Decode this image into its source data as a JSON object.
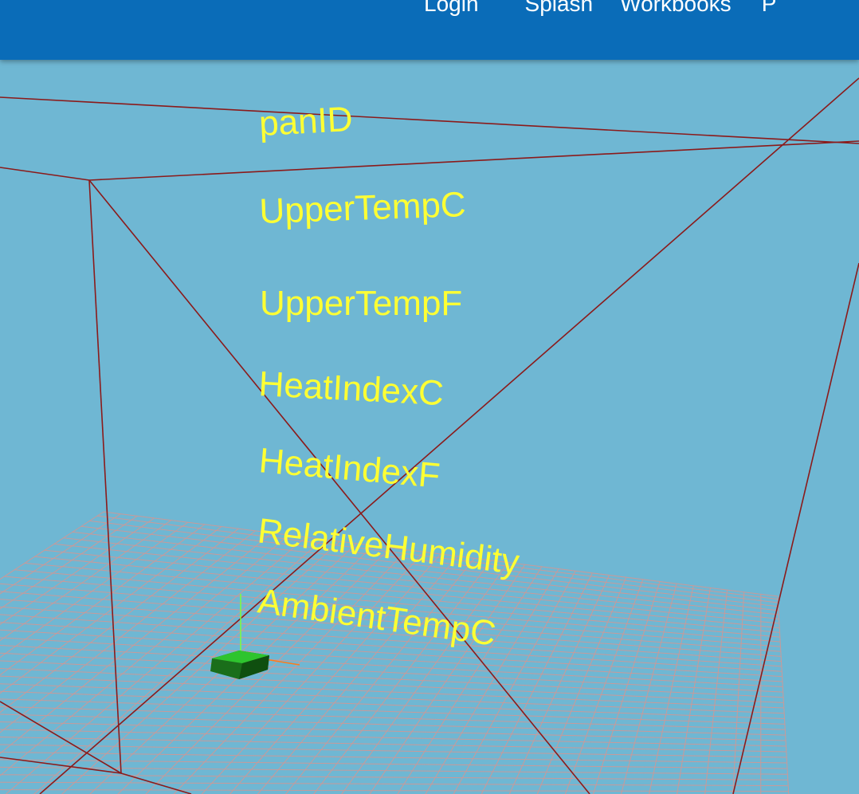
{
  "nav": {
    "items": [
      "Login",
      "Splash",
      "Workbooks",
      "P"
    ]
  },
  "scene": {
    "background": "#6fb7d3",
    "wireframe_color": "#8b1a1a",
    "grid_color": "#c89a9a",
    "label_color": "#ffff33",
    "object_color": "#1f8f1f",
    "labels": [
      "panID",
      "UpperTempC",
      "UpperTempF",
      "HeatIndexC",
      "HeatIndexF",
      "RelativeHumidity",
      "AmbientTempC"
    ]
  }
}
